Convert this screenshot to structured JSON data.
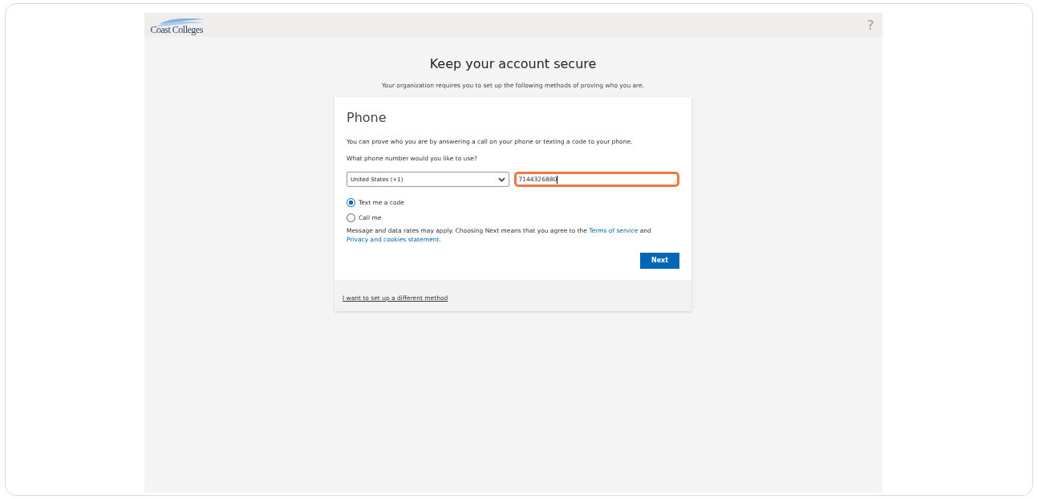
{
  "header": {
    "logo_text": "Coast Colleges",
    "help": "?"
  },
  "title": "Keep your account secure",
  "subtitle": "Your organization requires you to set up the following methods of proving who you are.",
  "card": {
    "heading": "Phone",
    "description": "You can prove who you are by answering a call on your phone or texting a code to your phone.",
    "question": "What phone number would you like to use?",
    "country": "United States (+1)",
    "phone_value": "7144326880",
    "highlighted": true,
    "options": [
      {
        "label": "Text me a code",
        "selected": true
      },
      {
        "label": "Call me",
        "selected": false
      }
    ],
    "notice": "Message and data rates may apply. Choosing Next means that you agree to the ",
    "terms_link": "Terms of service",
    "notice_and": " and ",
    "privacy_link": "Privacy and cookies statement",
    "notice_end": ".",
    "next_button": "Next"
  },
  "footer_link": "I want to set up a different method"
}
